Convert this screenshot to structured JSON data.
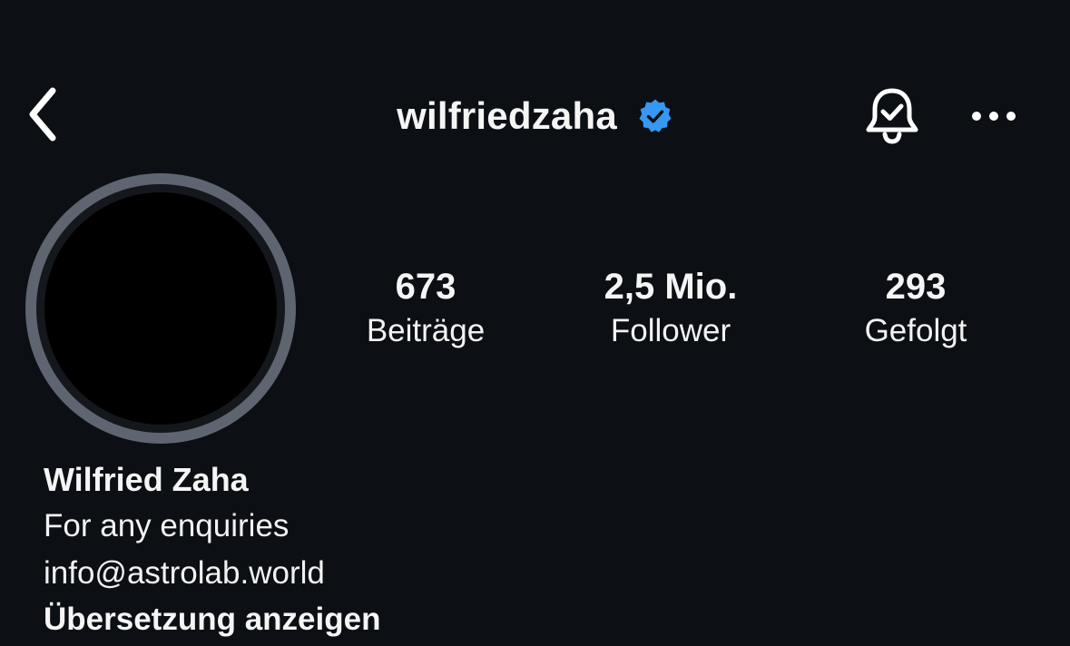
{
  "header": {
    "username": "wilfriedzaha",
    "verified": true,
    "accent_color": "#3897f0",
    "icons": {
      "back": "chevron-left-icon",
      "verified": "verified-badge-icon",
      "bell": "bell-check-icon",
      "more": "more-horizontal-icon"
    }
  },
  "stats": [
    {
      "count": "673",
      "label": "Beiträge"
    },
    {
      "count": "2,5 Mio.",
      "label": "Follower"
    },
    {
      "count": "293",
      "label": "Gefolgt"
    }
  ],
  "bio": {
    "name": "Wilfried Zaha",
    "lines": [
      "For any enquiries",
      "info@astrolab.world"
    ],
    "translate_label": "Übersetzung anzeigen"
  }
}
